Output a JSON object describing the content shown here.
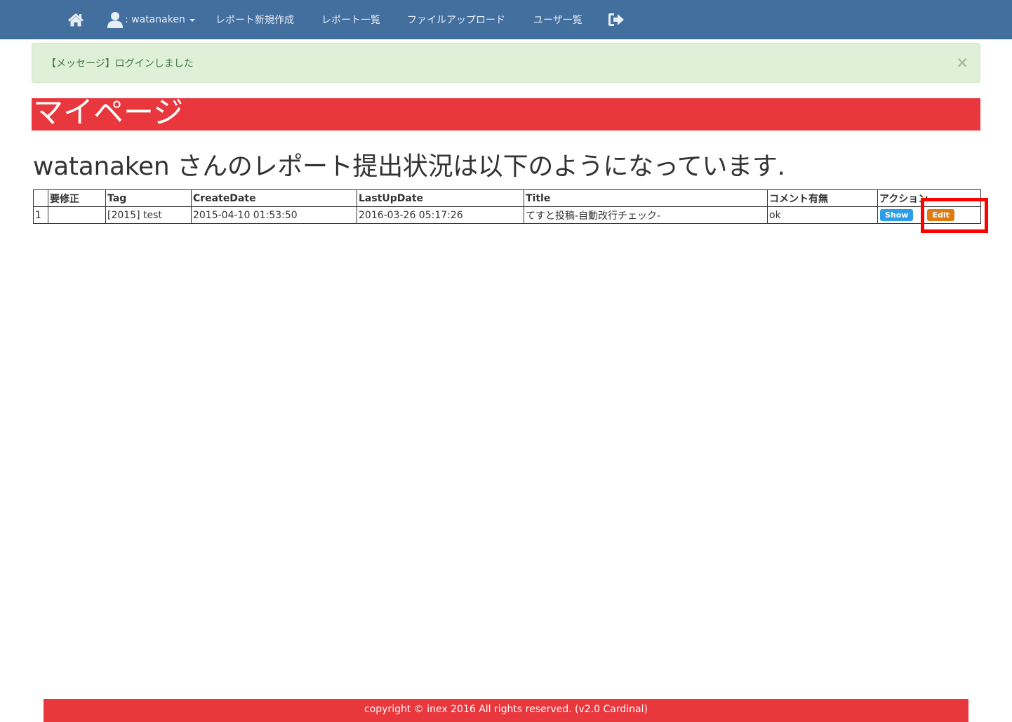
{
  "navbar": {
    "home_icon": "home-icon",
    "user_icon": "user-icon",
    "user_label": ": watanaken",
    "items": [
      {
        "label": "レポート新規作成"
      },
      {
        "label": "レポート一覧"
      },
      {
        "label": "ファイルアップロード"
      },
      {
        "label": "ユーザ一覧"
      }
    ],
    "logout_icon": "logout-icon"
  },
  "alert": {
    "message": "【メッセージ】ログインしました",
    "close_symbol": "×"
  },
  "page": {
    "title": "マイページ",
    "heading": "watanaken さんのレポート提出状況は以下のようになっています."
  },
  "table": {
    "headers": [
      "",
      "要修正",
      "Tag",
      "CreateDate",
      "LastUpDate",
      "Title",
      "コメント有無",
      "アクション"
    ],
    "rows": [
      {
        "no": "1",
        "needs_fix": "",
        "tag": "[2015] test",
        "create_date": "2015-04-10 01:53:50",
        "last_update": "2016-03-26 05:17:26",
        "title": "てすと投稿-自動改行チェック-",
        "comment": "ok",
        "show_label": "Show",
        "edit_label": "Edit"
      }
    ]
  },
  "footer": {
    "text": "copyright © inex 2016 All rights reserved. (v2.0 Cardinal)"
  },
  "colors": {
    "navbar": "#436f9f",
    "accent_red": "#e8373d",
    "alert_bg": "#dff0d8",
    "show_button": "#2a9ee8",
    "edit_button": "#dd7a10",
    "highlight": "#ff0000"
  }
}
